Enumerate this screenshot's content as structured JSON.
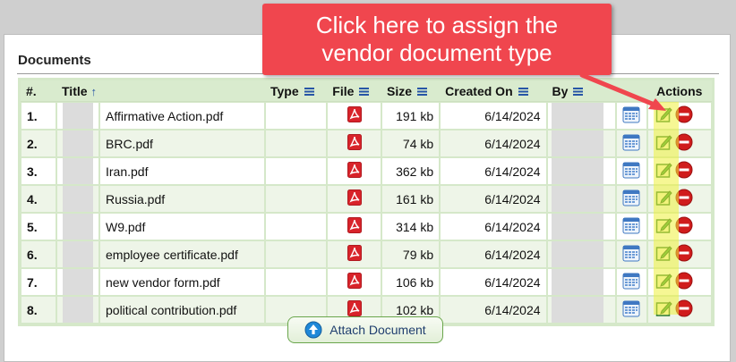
{
  "section": {
    "title": "Documents"
  },
  "table": {
    "headers": {
      "num": "#.",
      "title": "Title",
      "type": "Type",
      "file": "File",
      "size": "Size",
      "created": "Created On",
      "by": "By",
      "actions": "Actions"
    },
    "rows": [
      {
        "num": "1.",
        "title": "Affirmative Action.pdf",
        "type": "",
        "size": "191 kb",
        "created": "6/14/2024"
      },
      {
        "num": "2.",
        "title": "BRC.pdf",
        "type": "",
        "size": "74 kb",
        "created": "6/14/2024"
      },
      {
        "num": "3.",
        "title": "Iran.pdf",
        "type": "",
        "size": "362 kb",
        "created": "6/14/2024"
      },
      {
        "num": "4.",
        "title": "Russia.pdf",
        "type": "",
        "size": "161 kb",
        "created": "6/14/2024"
      },
      {
        "num": "5.",
        "title": "W9.pdf",
        "type": "",
        "size": "314 kb",
        "created": "6/14/2024"
      },
      {
        "num": "6.",
        "title": "employee certificate.pdf",
        "type": "",
        "size": "79 kb",
        "created": "6/14/2024"
      },
      {
        "num": "7.",
        "title": "new vendor form.pdf",
        "type": "",
        "size": "106 kb",
        "created": "6/14/2024"
      },
      {
        "num": "8.",
        "title": "political contribution.pdf",
        "type": "",
        "size": "102 kb",
        "created": "6/14/2024"
      }
    ]
  },
  "attach_button": {
    "label": "Attach Document"
  },
  "callout": {
    "line1": "Click here to assign the",
    "line2": "vendor document type"
  },
  "icons": {
    "sort": "arrow-up-icon",
    "column_menu": "menu-icon",
    "file": "pdf-icon",
    "calendar": "calendar-icon",
    "edit": "edit-icon",
    "delete": "delete-icon",
    "attach": "upload-arrow-icon"
  },
  "colors": {
    "header_bg": "#d9ebce",
    "row_alt_bg": "#eef5e8",
    "callout_bg": "#f0464e",
    "highlight": "#eef03c",
    "pdf_red": "#d8232a",
    "delete_red": "#d01c1c"
  }
}
